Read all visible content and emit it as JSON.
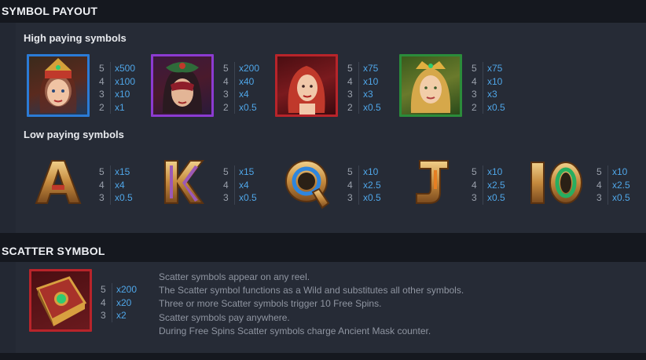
{
  "symbol_payout": {
    "title": "SYMBOL PAYOUT",
    "high_title": "High paying symbols",
    "low_title": "Low paying symbols",
    "high": [
      {
        "name": "Warrior queen",
        "frame_color": "#2b7bd6",
        "payouts": [
          {
            "count": "5",
            "mult": "x500"
          },
          {
            "count": "4",
            "mult": "x100"
          },
          {
            "count": "3",
            "mult": "x10"
          },
          {
            "count": "2",
            "mult": "x1"
          }
        ]
      },
      {
        "name": "Mask woman",
        "frame_color": "#8c3bd1",
        "payouts": [
          {
            "count": "5",
            "mult": "x200"
          },
          {
            "count": "4",
            "mult": "x40"
          },
          {
            "count": "3",
            "mult": "x4"
          },
          {
            "count": "2",
            "mult": "x0.5"
          }
        ]
      },
      {
        "name": "Red hair woman",
        "frame_color": "#b8242a",
        "payouts": [
          {
            "count": "5",
            "mult": "x75"
          },
          {
            "count": "4",
            "mult": "x10"
          },
          {
            "count": "3",
            "mult": "x3"
          },
          {
            "count": "2",
            "mult": "x0.5"
          }
        ]
      },
      {
        "name": "Blonde woman",
        "frame_color": "#2b8c3a",
        "payouts": [
          {
            "count": "5",
            "mult": "x75"
          },
          {
            "count": "4",
            "mult": "x10"
          },
          {
            "count": "3",
            "mult": "x3"
          },
          {
            "count": "2",
            "mult": "x0.5"
          }
        ]
      }
    ],
    "low": [
      {
        "glyph": "A",
        "gem_color": "#c0392b",
        "payouts": [
          {
            "count": "5",
            "mult": "x15"
          },
          {
            "count": "4",
            "mult": "x4"
          },
          {
            "count": "3",
            "mult": "x0.5"
          }
        ]
      },
      {
        "glyph": "K",
        "gem_color": "#9b59b6",
        "payouts": [
          {
            "count": "5",
            "mult": "x15"
          },
          {
            "count": "4",
            "mult": "x4"
          },
          {
            "count": "3",
            "mult": "x0.5"
          }
        ]
      },
      {
        "glyph": "Q",
        "gem_color": "#2e86de",
        "payouts": [
          {
            "count": "5",
            "mult": "x10"
          },
          {
            "count": "4",
            "mult": "x2.5"
          },
          {
            "count": "3",
            "mult": "x0.5"
          }
        ]
      },
      {
        "glyph": "J",
        "gem_color": "#e67e22",
        "payouts": [
          {
            "count": "5",
            "mult": "x10"
          },
          {
            "count": "4",
            "mult": "x2.5"
          },
          {
            "count": "3",
            "mult": "x0.5"
          }
        ]
      },
      {
        "glyph": "10",
        "gem_color": "#27ae60",
        "payouts": [
          {
            "count": "5",
            "mult": "x10"
          },
          {
            "count": "4",
            "mult": "x2.5"
          },
          {
            "count": "3",
            "mult": "x0.5"
          }
        ]
      }
    ]
  },
  "scatter": {
    "title": "SCATTER SYMBOL",
    "payouts": [
      {
        "count": "5",
        "mult": "x200"
      },
      {
        "count": "4",
        "mult": "x20"
      },
      {
        "count": "3",
        "mult": "x2"
      }
    ],
    "lines": [
      "Scatter symbols appear on any reel.",
      "The Scatter symbol functions as a Wild and substitutes all other symbols.",
      "Three or more Scatter symbols trigger 10 Free Spins.",
      "Scatter symbols pay anywhere.",
      "During Free Spins Scatter symbols charge Ancient Mask counter."
    ]
  }
}
